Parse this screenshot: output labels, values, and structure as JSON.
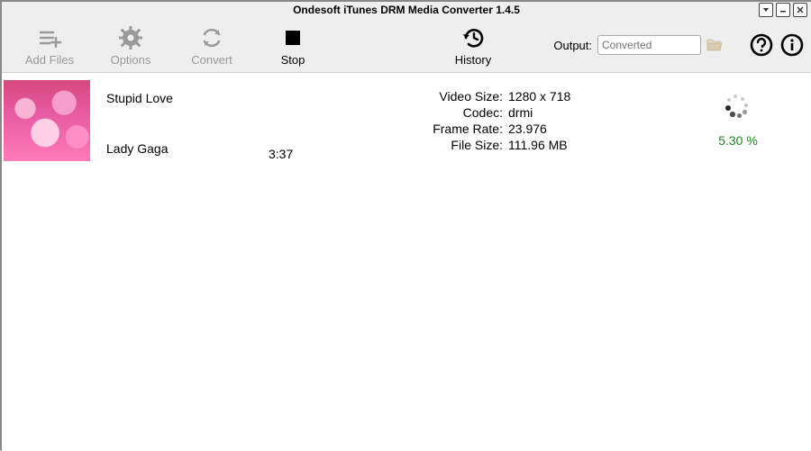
{
  "window": {
    "title": "Ondesoft iTunes DRM Media Converter 1.4.5"
  },
  "toolbar": {
    "add_files": "Add Files",
    "options": "Options",
    "convert": "Convert",
    "stop": "Stop",
    "history": "History"
  },
  "output": {
    "label": "Output:",
    "placeholder": "Converted",
    "value": ""
  },
  "item": {
    "title": "Stupid Love",
    "artist": "Lady Gaga",
    "duration": "3:37",
    "meta": {
      "video_size_k": "Video Size:",
      "video_size_v": "1280 x 718",
      "codec_k": "Codec:",
      "codec_v": "drmi",
      "frame_rate_k": "Frame Rate:",
      "frame_rate_v": "23.976",
      "file_size_k": "File Size:",
      "file_size_v": "111.96 MB"
    },
    "progress": "5.30 %"
  }
}
